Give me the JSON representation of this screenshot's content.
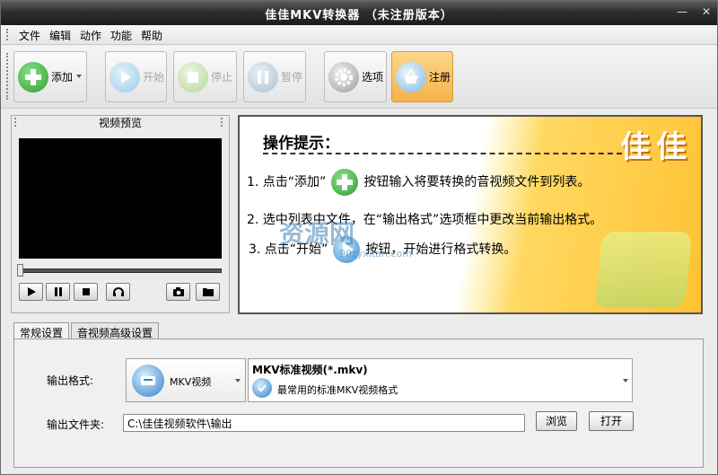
{
  "window": {
    "title": "佳佳MKV转换器  （未注册版本）"
  },
  "menu": [
    "文件",
    "编辑",
    "动作",
    "功能",
    "帮助"
  ],
  "toolbar": {
    "add": "添加",
    "start": "开始",
    "stop": "停止",
    "pause": "暂停",
    "options": "选项",
    "register": "注册"
  },
  "preview": {
    "title": "视频预览"
  },
  "tips": {
    "title": "操作提示：",
    "line1_a": "1. 点击“添加”",
    "line1_b": "按钮输入将要转换的音视频文件到列表。",
    "line2": "2. 选中列表中文件，在“输出格式”选项框中更改当前输出格式。",
    "line3_a": "3. 点击“开始”",
    "line3_b": "按钮，开始进行格式转换。",
    "deco": "佳佳"
  },
  "watermark": {
    "text": "资源网",
    "url": "90zyxitan.com"
  },
  "tabs": [
    "常规设置",
    "音视频高级设置"
  ],
  "settings": {
    "format_label": "输出格式:",
    "format_value": "MKV视频",
    "preset_title": "MKV标准视频(*.mkv)",
    "preset_desc": "最常用的标准MKV视频格式",
    "folder_label": "输出文件夹:",
    "folder_value": "C:\\佳佳视频软件\\输出",
    "browse": "浏览",
    "open": "打开"
  },
  "colors": {
    "accent_green": "#3cae3c",
    "disabled_blue": "#9cc9e8",
    "register_bg": "#f5b24a"
  }
}
